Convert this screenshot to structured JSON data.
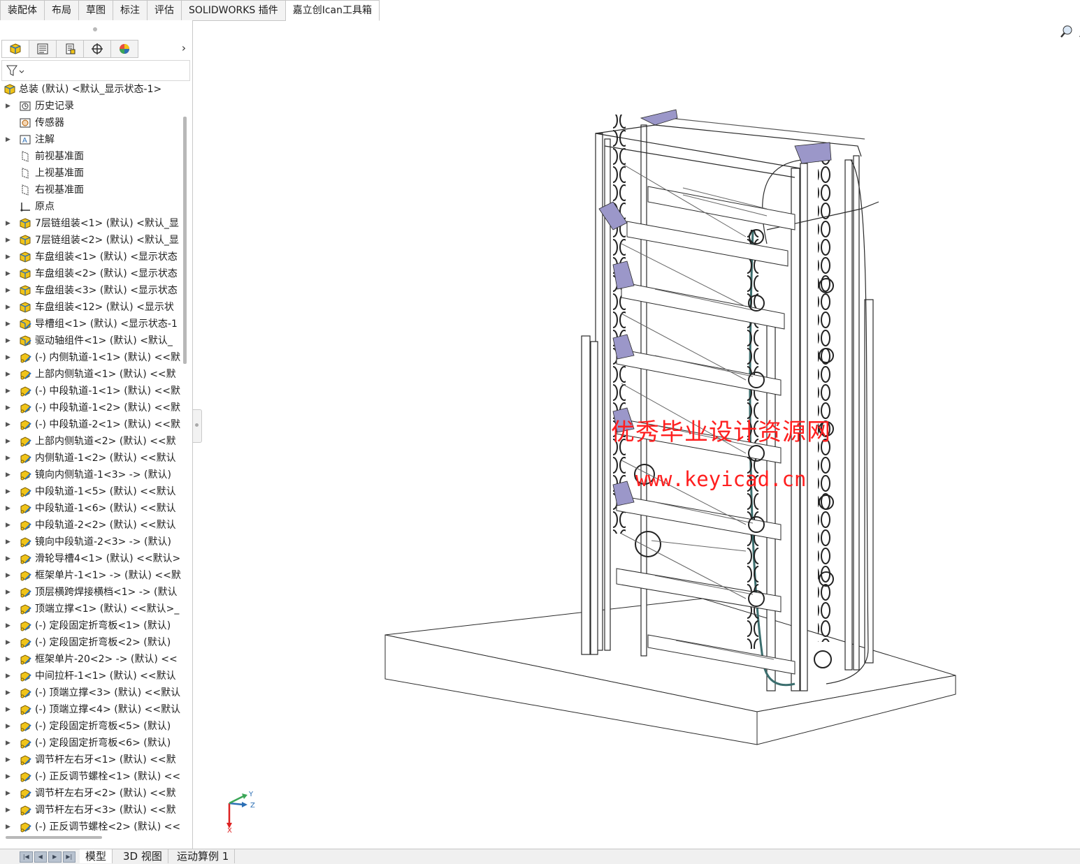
{
  "command_tabs": [
    "装配体",
    "布局",
    "草图",
    "标注",
    "评估",
    "SOLIDWORKS 插件",
    "嘉立创Ican工具箱"
  ],
  "active_command_tab": "嘉立创Ican工具箱",
  "panel_tabs": [
    "featuremanager-tree-icon",
    "property-manager-icon",
    "configuration-manager-icon",
    "dimxpert-manager-icon",
    "display-manager-icon"
  ],
  "panel_more": "›",
  "filter": {
    "icon": "funnel-filter-icon"
  },
  "tree": {
    "root": "总装 (默认) <默认_显示状态-1>",
    "items": [
      {
        "label": "历史记录",
        "icon": "history"
      },
      {
        "label": "传感器",
        "icon": "sensor"
      },
      {
        "label": "注解",
        "icon": "annotation"
      },
      {
        "label": "前视基准面",
        "icon": "plane"
      },
      {
        "label": "上视基准面",
        "icon": "plane"
      },
      {
        "label": "右视基准面",
        "icon": "plane"
      },
      {
        "label": "原点",
        "icon": "origin"
      },
      {
        "label": "7层链组装<1> (默认) <默认_显",
        "icon": "assembly"
      },
      {
        "label": "7层链组装<2> (默认) <默认_显",
        "icon": "assembly"
      },
      {
        "label": "车盘组装<1> (默认) <显示状态",
        "icon": "assembly"
      },
      {
        "label": "车盘组装<2> (默认) <显示状态",
        "icon": "assembly"
      },
      {
        "label": "车盘组装<3> (默认) <显示状态",
        "icon": "assembly"
      },
      {
        "label": "车盘组装<12> (默认) <显示状",
        "icon": "assembly"
      },
      {
        "label": "导槽组<1> (默认) <显示状态-1",
        "icon": "assembly-edit"
      },
      {
        "label": "驱动轴组件<1> (默认) <默认_",
        "icon": "assembly-edit"
      },
      {
        "label": "(-) 内侧轨道-1<1> (默认) <<默",
        "icon": "part-edit"
      },
      {
        "label": "上部内侧轨道<1> (默认) <<默",
        "icon": "part-edit"
      },
      {
        "label": "(-) 中段轨道-1<1> (默认) <<默",
        "icon": "part-edit"
      },
      {
        "label": "(-) 中段轨道-1<2> (默认) <<默",
        "icon": "part-edit"
      },
      {
        "label": "(-) 中段轨道-2<1> (默认) <<默",
        "icon": "part-edit"
      },
      {
        "label": "上部内侧轨道<2> (默认) <<默",
        "icon": "part-edit"
      },
      {
        "label": "内侧轨道-1<2> (默认) <<默认",
        "icon": "part-edit"
      },
      {
        "label": "镜向内侧轨道-1<3> -> (默认)",
        "icon": "part-edit"
      },
      {
        "label": "中段轨道-1<5> (默认) <<默认",
        "icon": "part-edit"
      },
      {
        "label": "中段轨道-1<6> (默认) <<默认",
        "icon": "part-edit"
      },
      {
        "label": "中段轨道-2<2> (默认) <<默认",
        "icon": "part-edit"
      },
      {
        "label": "镜向中段轨道-2<3> -> (默认)",
        "icon": "part-edit"
      },
      {
        "label": "滑轮导槽4<1> (默认) <<默认>",
        "icon": "part-edit"
      },
      {
        "label": "框架单片-1<1> -> (默认) <<默",
        "icon": "part-edit"
      },
      {
        "label": "顶层横跨焊接横档<1> -> (默认",
        "icon": "part-edit"
      },
      {
        "label": "顶端立撑<1> (默认) <<默认>_",
        "icon": "part-edit"
      },
      {
        "label": "(-) 定段固定折弯板<1> (默认)",
        "icon": "part-edit"
      },
      {
        "label": "(-) 定段固定折弯板<2> (默认)",
        "icon": "part-edit"
      },
      {
        "label": "框架单片-20<2> -> (默认) <<",
        "icon": "part-edit"
      },
      {
        "label": "中间拉杆-1<1> (默认) <<默认",
        "icon": "part-edit"
      },
      {
        "label": "(-) 顶端立撑<3> (默认) <<默认",
        "icon": "part-edit"
      },
      {
        "label": "(-) 顶端立撑<4> (默认) <<默认",
        "icon": "part-edit"
      },
      {
        "label": "(-) 定段固定折弯板<5> (默认)",
        "icon": "part-edit"
      },
      {
        "label": "(-) 定段固定折弯板<6> (默认)",
        "icon": "part-edit"
      },
      {
        "label": "调节杆左右牙<1> (默认) <<默",
        "icon": "part-edit"
      },
      {
        "label": "(-) 正反调节螺栓<1> (默认) <<",
        "icon": "part-edit"
      },
      {
        "label": "调节杆左右牙<2> (默认) <<默",
        "icon": "part-edit"
      },
      {
        "label": "调节杆左右牙<3> (默认) <<默",
        "icon": "part-edit"
      },
      {
        "label": "(-) 正反调节螺栓<2> (默认) <<",
        "icon": "part-edit"
      }
    ]
  },
  "headsup_toolbar": [
    "zoom-to-fit-icon",
    "zoom-to-area-icon",
    "previous-view-icon",
    "section-view-icon",
    "dynamic-annotation-icon",
    "view-orientation-icon",
    "display-style-icon",
    "hide-show-icon",
    "edit-appearance-icon",
    "apply-scene-icon"
  ],
  "viewport": {
    "watermark_text": "优秀毕业设计资源网",
    "watermark_url": "www.keyicad.cn",
    "triad_labels": {
      "y": "Y",
      "z": "Z",
      "x": "X"
    }
  },
  "bottom_tabs": [
    "模型",
    "3D 视图",
    "运动算例 1"
  ],
  "active_bottom_tab": "模型",
  "nav_buttons": [
    "|◀",
    "◀",
    "▶",
    "▶|"
  ],
  "colors": {
    "accent": "#ff1f1f",
    "icon_yellow": "#f0c419",
    "icon_blue": "#2c6fb5",
    "model_line": "#2a2a2a",
    "model_purple": "#9b97c9"
  }
}
